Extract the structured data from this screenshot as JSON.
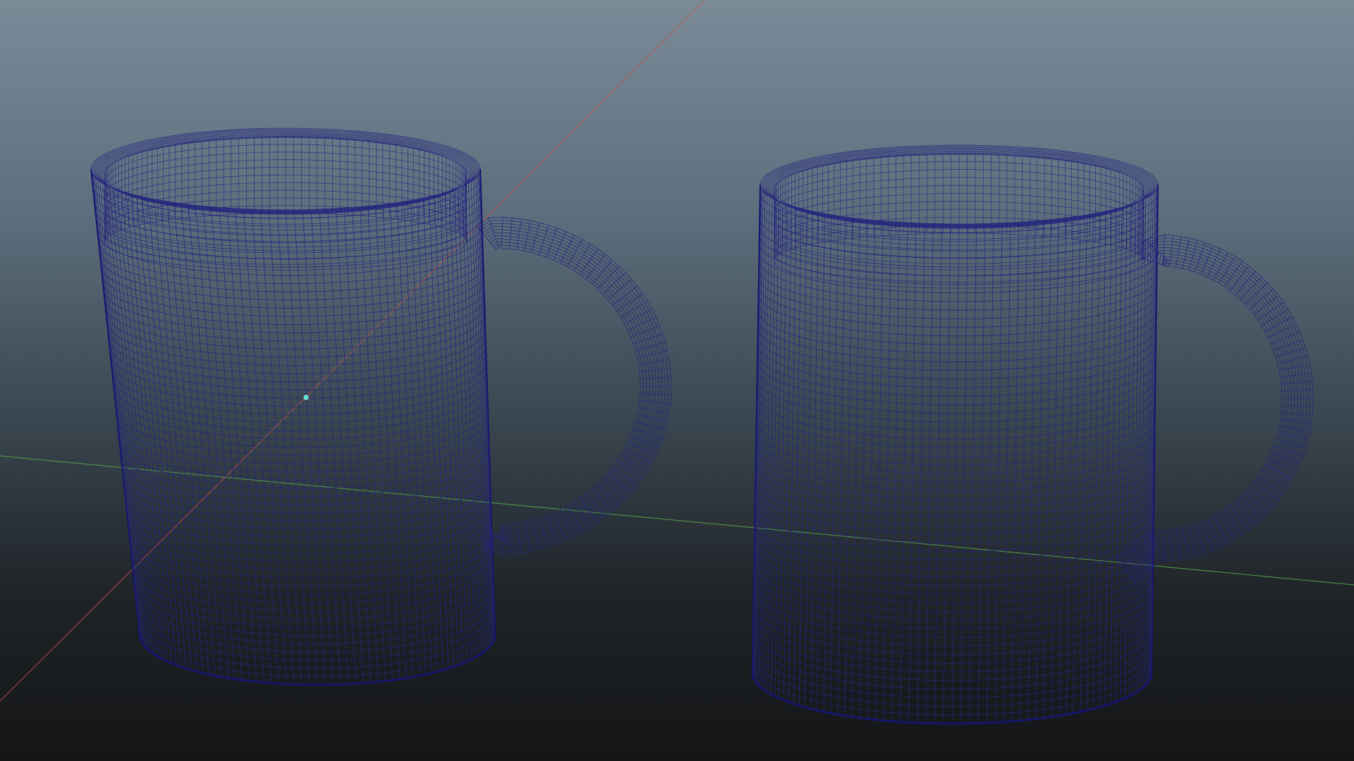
{
  "viewport": {
    "background_top": "#7a8b98",
    "background_bottom": "#141516",
    "wire_color": "#24267e",
    "wire_edge_color": "#16166e",
    "axis_x_color": "#c0524c",
    "axis_z_color": "#5aa048",
    "pivot_color": "#46e0d0"
  },
  "objects": [
    {
      "name": "mug",
      "type": "mesh",
      "display": "wireframe"
    },
    {
      "name": "mug",
      "type": "mesh",
      "display": "wireframe"
    }
  ]
}
